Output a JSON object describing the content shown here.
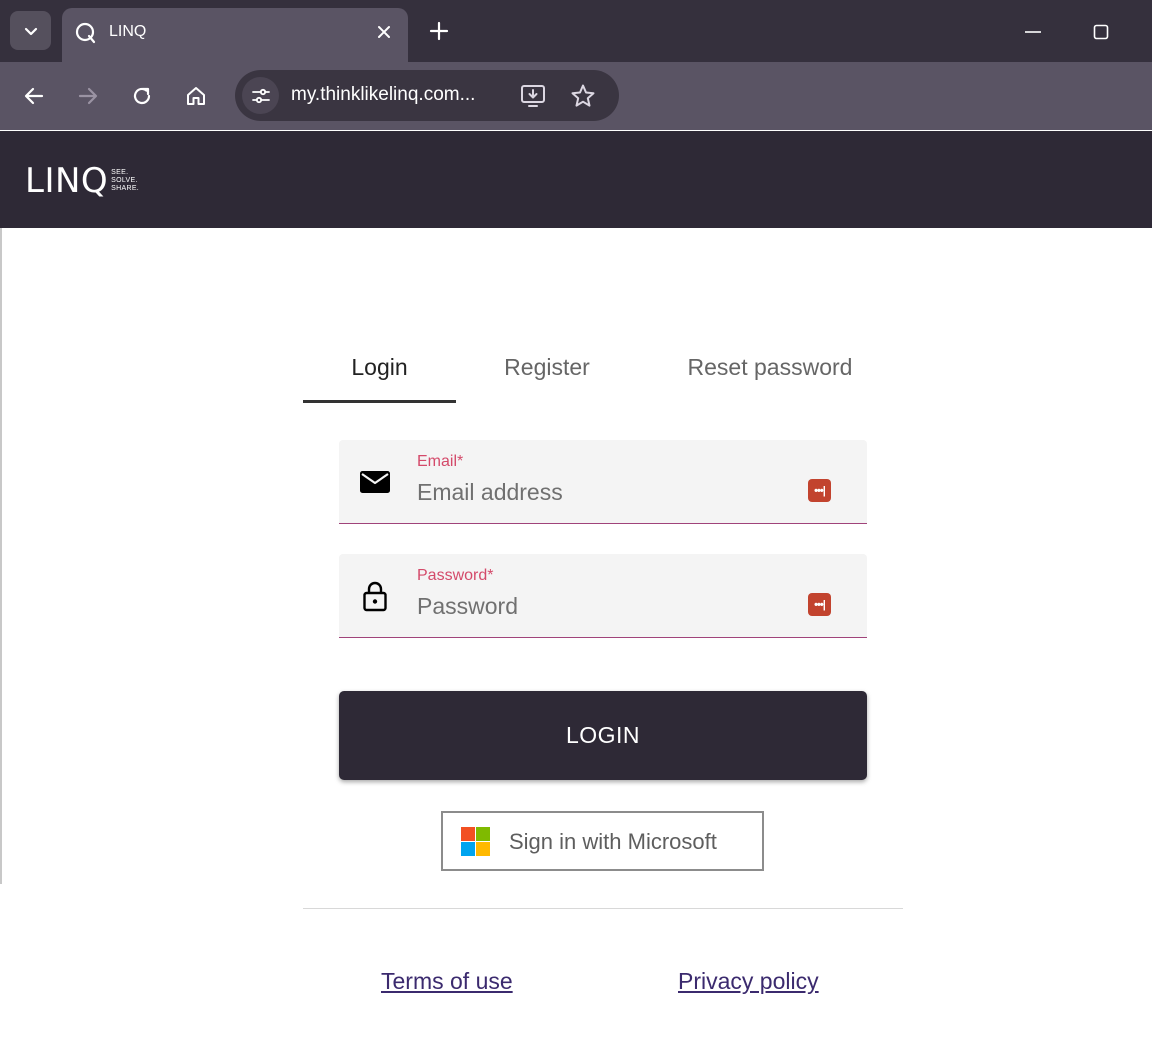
{
  "browser": {
    "tab_title": "LINQ",
    "url": "my.thinklikelinq.com...",
    "icons": {
      "tab_search": "chevron-down-icon",
      "favicon": "linq-q-icon",
      "close_tab": "close-icon",
      "new_tab": "plus-icon",
      "back": "arrow-left-icon",
      "forward": "arrow-right-icon",
      "reload": "reload-icon",
      "home": "home-icon",
      "site_info": "tune-icon",
      "install": "install-app-icon",
      "bookmark": "star-icon",
      "minimize": "minimize-icon",
      "maximize": "maximize-icon"
    }
  },
  "header": {
    "logo_word": "LINQ",
    "logo_tagline": [
      "SEE.",
      "SOLVE.",
      "SHARE."
    ]
  },
  "auth": {
    "tabs": [
      {
        "label": "Login",
        "active": true
      },
      {
        "label": "Register",
        "active": false
      },
      {
        "label": "Reset password",
        "active": false
      }
    ],
    "email": {
      "label": "Email*",
      "placeholder": "Email address",
      "value": ""
    },
    "password": {
      "label": "Password*",
      "placeholder": "Password",
      "value": ""
    },
    "password_manager_glyph": "•••|",
    "login_button": "LOGIN",
    "microsoft_button": "Sign in with Microsoft"
  },
  "footer": {
    "terms": "Terms of use",
    "privacy": "Privacy policy"
  },
  "colors": {
    "chrome_dark": "#35303d",
    "chrome_tab": "#5a5464",
    "app_header": "#2e2936",
    "label_red": "#d44a6a",
    "underline_purple": "#a0437a",
    "link": "#3b2a6e",
    "pw_manager": "#c2432e"
  }
}
